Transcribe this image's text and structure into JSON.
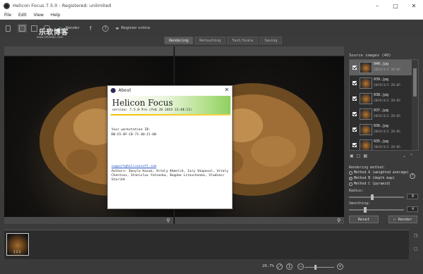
{
  "window": {
    "title": "Helicon Focus 7.5.0 - Registered: unlimited"
  },
  "menu": [
    "File",
    "Edit",
    "View",
    "Help"
  ],
  "toolbar": {
    "render_label": "Render",
    "register_label": "Register online",
    "watermark": "乐软博客",
    "watermark_url": "www.isharepc.com"
  },
  "tabs": [
    "Rendering",
    "Retouching",
    "Text/Scale",
    "Saving"
  ],
  "active_tab": "Rendering",
  "about": {
    "title": "About",
    "app_name": "Helicon Focus",
    "version": "version: 7.5.0 Pro (Feb 20 2019 13:48:21)",
    "workstation_label": "Your workstation ID:",
    "workstation_id": "B0-E5-8F-CD-71-40-21-00",
    "email": "support@heliconsoft.com",
    "authors": "Authors: Danylo Kozub, Vitaly Khmelik, Jury Shapoval, Vitaly Chentsov, Stanislav Yatsenko, Bogdan Litovchenko, Vladimir Starikh"
  },
  "source": {
    "label": "Source images (40)",
    "items": [
      {
        "name": "040.jpg",
        "date": "2019/3/2 20:05",
        "selected": true
      },
      {
        "name": "039.jpg",
        "date": "2019/3/2 20:05",
        "selected": false
      },
      {
        "name": "038.jpg",
        "date": "2019/3/2 20:05",
        "selected": false
      },
      {
        "name": "037.jpg",
        "date": "2019/3/2 20:05",
        "selected": false
      },
      {
        "name": "036.jpg",
        "date": "2019/3/2 20:05",
        "selected": false
      },
      {
        "name": "035.jpg",
        "date": "2019/3/2 20:05",
        "selected": false
      }
    ]
  },
  "rendering": {
    "label": "Rendering method:",
    "methods": [
      "Method A (weighted average)",
      "Method B (depth map)",
      "Method C (pyramid)"
    ],
    "selected_method": 1,
    "radius_label": "Radius:",
    "radius": "8",
    "radius_level": 0.42,
    "smoothing_label": "Smoothing:",
    "smoothing": "4",
    "smoothing_level": 0.28,
    "reset_label": "Reset",
    "render_label": "Render"
  },
  "film": {
    "caption": "1 2 3"
  },
  "status": {
    "zoom": "29.7%"
  },
  "icons": [
    "app-icon",
    "new-file-icon",
    "layout-single-icon",
    "layout-split-icon",
    "camera-icon",
    "render-play-icon",
    "facebook-icon",
    "help-icon",
    "key-icon",
    "magnifier-icon",
    "zoom-out-icon",
    "zoom-in-icon",
    "fit-icon"
  ]
}
